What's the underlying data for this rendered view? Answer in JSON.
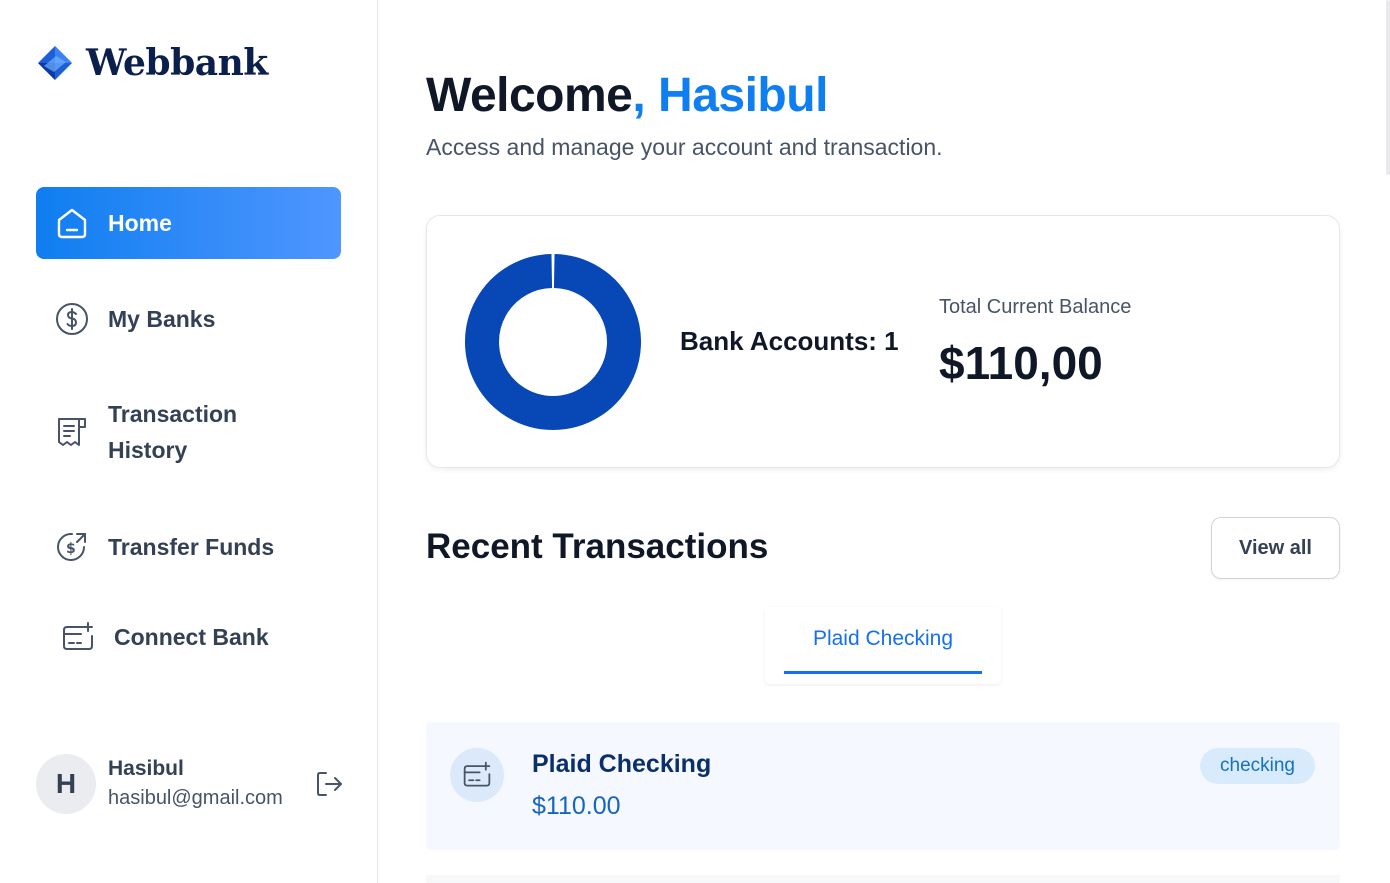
{
  "brand": {
    "name": "Webbank",
    "logo_icon": "diamond-logo-icon"
  },
  "sidebar": {
    "items": [
      {
        "label": "Home",
        "icon": "home-icon",
        "active": true
      },
      {
        "label": "My Banks",
        "icon": "dollar-circle-icon",
        "active": false
      },
      {
        "label": "Transaction History",
        "icon": "receipt-icon",
        "active": false
      },
      {
        "label": "Transfer Funds",
        "icon": "money-send-icon",
        "active": false
      },
      {
        "label": "Connect Bank",
        "icon": "card-add-icon",
        "active": false
      }
    ],
    "user": {
      "initial": "H",
      "name": "Hasibul",
      "email": "hasibul@gmail.com",
      "logout_icon": "logout-icon"
    }
  },
  "header": {
    "welcome": "Welcome",
    "name": ", Hasibul",
    "subtitle": "Access and manage your account and transaction."
  },
  "balance": {
    "accounts_label": "Bank Accounts: 1",
    "total_label": "Total Current Balance",
    "total_value": "$110,00"
  },
  "chart_data": {
    "type": "pie",
    "categories": [
      "Plaid Checking"
    ],
    "values": [
      110
    ],
    "colors": [
      "#0747b6"
    ]
  },
  "recent": {
    "title": "Recent Transactions",
    "view_all": "View all",
    "tabs": [
      "Plaid Checking"
    ],
    "account": {
      "name": "Plaid Checking",
      "amount": "$110.00",
      "badge": "checking",
      "icon": "card-add-icon"
    }
  },
  "colors": {
    "accent": "#0f7ef0",
    "donut": "#0747b6",
    "badge_bg": "#d8ebfd"
  }
}
